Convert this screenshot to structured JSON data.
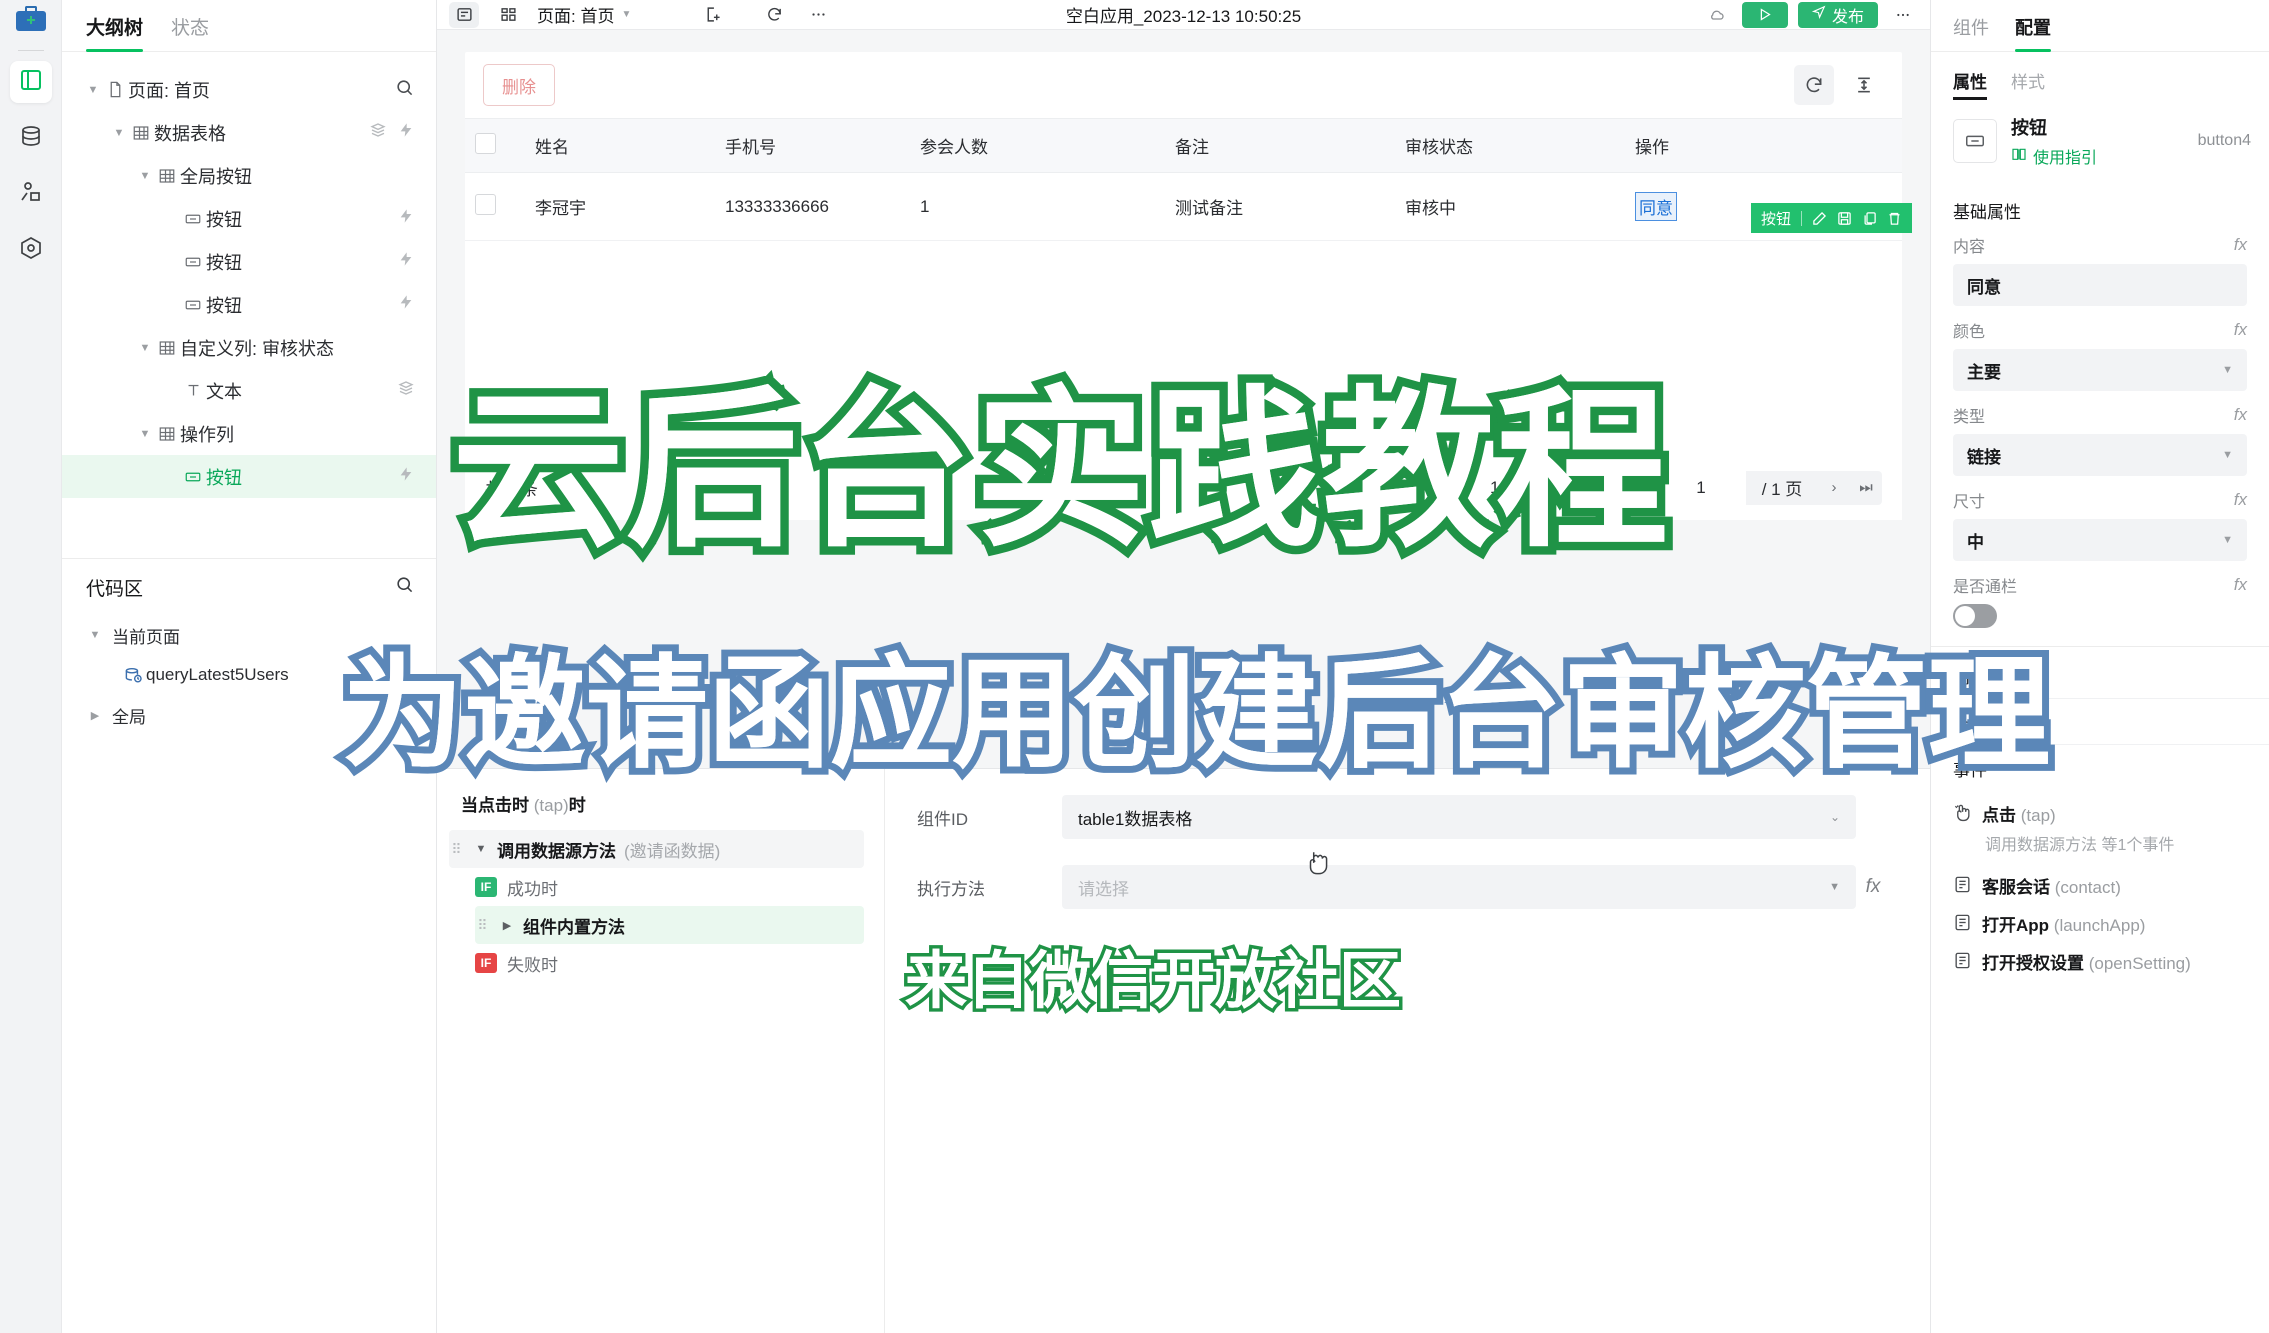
{
  "rail": {
    "logo_name": "toolbox-logo",
    "items": [
      {
        "name": "pages-icon",
        "active": true
      },
      {
        "name": "database-icon",
        "active": false
      },
      {
        "name": "users-icon",
        "active": false
      },
      {
        "name": "settings-icon",
        "active": false
      }
    ]
  },
  "topbar": {
    "outline_toggle": "outline-panel-icon",
    "grid_toggle": "component-panel-icon",
    "page_label": "页面: 首页",
    "add_page_icon": "add-page-icon",
    "refresh_icon": "refresh-icon",
    "more_icon": "more-icon",
    "title": "空白应用_2023-12-13 10:50:25",
    "run_label": "预览",
    "publish_label": "发布"
  },
  "left_panel": {
    "tabs": [
      {
        "label": "大纲树",
        "active": true
      },
      {
        "label": "状态",
        "active": false
      }
    ],
    "search_icon": "search-icon",
    "tree": [
      {
        "label": "页面: 首页",
        "icon": "file-icon",
        "indent": 0,
        "caret": "down",
        "selected": false,
        "badges": []
      },
      {
        "label": "数据表格",
        "icon": "table-icon",
        "indent": 1,
        "caret": "down",
        "selected": false,
        "badges": [
          "data-icon",
          "event-icon"
        ]
      },
      {
        "label": "全局按钮",
        "icon": "table-icon",
        "indent": 2,
        "caret": "down",
        "selected": false,
        "badges": []
      },
      {
        "label": "按钮",
        "icon": "button-icon",
        "indent": 3,
        "caret": "none",
        "selected": false,
        "badges": [
          "event-icon"
        ]
      },
      {
        "label": "按钮",
        "icon": "button-icon",
        "indent": 3,
        "caret": "none",
        "selected": false,
        "badges": [
          "event-icon"
        ]
      },
      {
        "label": "按钮",
        "icon": "button-icon",
        "indent": 3,
        "caret": "none",
        "selected": false,
        "badges": [
          "event-icon"
        ]
      },
      {
        "label": "自定义列: 审核状态",
        "icon": "table-icon",
        "indent": 2,
        "caret": "down",
        "selected": false,
        "badges": []
      },
      {
        "label": "文本",
        "icon": "text-icon",
        "indent": 3,
        "caret": "none",
        "selected": false,
        "badges": [
          "data-icon"
        ]
      },
      {
        "label": "操作列",
        "icon": "table-icon",
        "indent": 2,
        "caret": "down",
        "selected": false,
        "badges": []
      },
      {
        "label": "按钮",
        "icon": "button-icon",
        "indent": 3,
        "caret": "none",
        "selected": true,
        "badges": [
          "event-icon"
        ]
      }
    ],
    "code_area": {
      "title": "代码区",
      "search_icon": "search-icon",
      "rows": [
        {
          "label": "当前页面",
          "caret": "down",
          "icon": "none",
          "indent": 0
        },
        {
          "label": "queryLatest5Users",
          "caret": "none",
          "icon": "datasource-icon",
          "indent": 1
        },
        {
          "label": "全局",
          "caret": "right",
          "icon": "none",
          "indent": 0
        }
      ]
    }
  },
  "table": {
    "delete_label": "删除",
    "refresh_icon": "refresh-icon",
    "height_icon": "row-height-icon",
    "columns": [
      "姓名",
      "手机号",
      "参会人数",
      "备注",
      "审核状态",
      "操作"
    ],
    "rows": [
      {
        "姓名": "李冠宇",
        "手机号": "13333336666",
        "参会人数": "1",
        "备注": "测试备注",
        "审核状态": "审核中",
        "操作": "同意"
      }
    ],
    "selection_toolbar": {
      "label": "按钮",
      "icons": [
        "edit-icon",
        "save-icon",
        "copy-icon",
        "delete-icon"
      ]
    },
    "pager": {
      "total": "共 1 条",
      "page_size": "10",
      "page_size_unit": "条 / 页",
      "current_page": "1",
      "total_pages": "/ 1 页",
      "first_icon": "first-page-icon",
      "prev_icon": "prev-page-icon",
      "next_icon": "next-page-icon",
      "last_icon": "last-page-icon"
    }
  },
  "event_editor": {
    "when_label": "当点击时",
    "when_key": "(tap)",
    "when_suffix": "时",
    "nodes": [
      {
        "name": "调用数据源方法",
        "sub": "(邀请函数据)",
        "caret": "down",
        "style": "grey"
      }
    ],
    "success_label": "成功时",
    "success_badge": "IF",
    "success_child": {
      "name": "组件内置方法",
      "caret": "right",
      "style": "green"
    },
    "fail_label": "失败时",
    "fail_badge": "IF",
    "form": {
      "component_id_label": "组件ID",
      "component_id_value": "table1数据表格",
      "method_label": "执行方法",
      "method_placeholder": "请选择",
      "fx_label": "fx"
    }
  },
  "right_panel": {
    "tabs": [
      {
        "label": "组件",
        "active": false
      },
      {
        "label": "配置",
        "active": true
      }
    ],
    "subtabs": [
      {
        "label": "属性",
        "active": true
      },
      {
        "label": "样式",
        "active": false
      }
    ],
    "component": {
      "icon": "button-icon",
      "name": "按钮",
      "guide_label": "使用指引",
      "guide_icon": "book-icon",
      "id": "button4"
    },
    "basic_section_title": "基础属性",
    "fields": [
      {
        "label": "内容",
        "value": "同意",
        "type": "text",
        "fx": "fx"
      },
      {
        "label": "颜色",
        "value": "主要",
        "type": "select",
        "fx": "fx"
      },
      {
        "label": "类型",
        "value": "链接",
        "type": "select",
        "fx": "fx"
      },
      {
        "label": "尺寸",
        "value": "中",
        "type": "select",
        "fx": "fx"
      },
      {
        "label": "是否通栏",
        "value": "",
        "type": "toggle",
        "fx": "fx"
      }
    ],
    "collapse_sections": [
      "高级属性",
      "条件展示",
      "事件"
    ],
    "events": [
      {
        "icon": "tap-icon",
        "name": "点击",
        "key": "(tap)",
        "desc": "调用数据源方法 等1个事件"
      },
      {
        "icon": "contact-icon",
        "name": "客服会话",
        "key": "(contact)",
        "desc": ""
      },
      {
        "icon": "launch-icon",
        "name": "打开App",
        "key": "(launchApp)",
        "desc": ""
      },
      {
        "icon": "setting-icon",
        "name": "打开授权设置",
        "key": "(openSetting)",
        "desc": ""
      }
    ]
  },
  "overlays": {
    "title": "云后台实践教程",
    "subtitle": "为邀请函应用创建后台审核管理",
    "source": "来自微信开放社区"
  },
  "colors": {
    "brand_green": "#07c160",
    "title_green": "#1f9346",
    "subtitle_blue": "#5b87b8",
    "link_blue": "#1a6fd6",
    "danger_red": "#e06c6c"
  }
}
